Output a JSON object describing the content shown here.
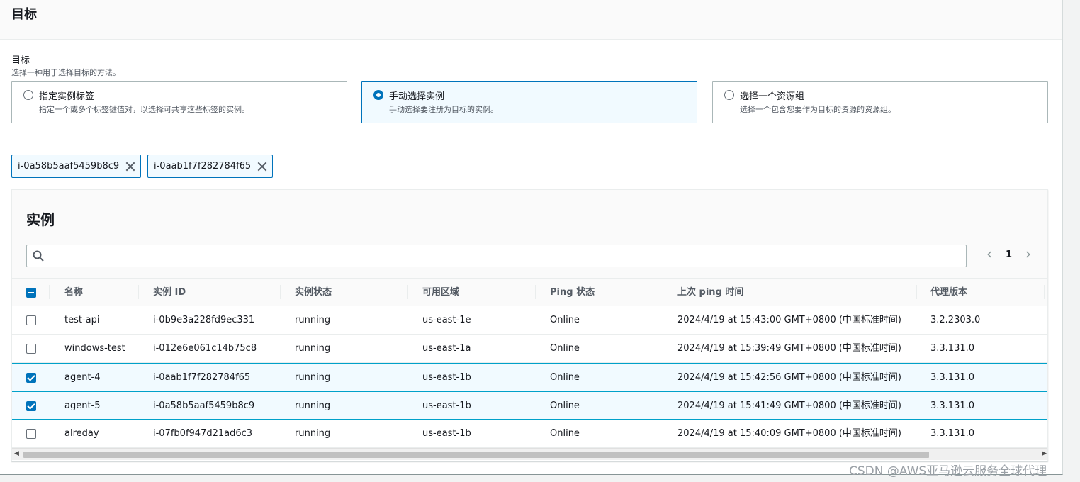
{
  "panel": {
    "title": "目标"
  },
  "field": {
    "label": "目标",
    "description": "选择一种用于选择目标的方法。"
  },
  "tiles": [
    {
      "label": "指定实例标签",
      "description": "指定一个或多个标签键值对，以选择可共享这些标签的实例。",
      "selected": false
    },
    {
      "label": "手动选择实例",
      "description": "手动选择要注册为目标的实例。",
      "selected": true
    },
    {
      "label": "选择一个资源组",
      "description": "选择一个包含您要作为目标的资源的资源组。",
      "selected": false
    }
  ],
  "tokens": [
    "i-0a58b5aaf5459b8c9",
    "i-0aab1f7f282784f65"
  ],
  "table": {
    "title": "实例",
    "search": {
      "value": "",
      "placeholder": ""
    },
    "pagination": {
      "current_page": "1"
    },
    "columns": [
      "名称",
      "实例 ID",
      "实例状态",
      "可用区域",
      "Ping 状态",
      "上次 ping 时间",
      "代理版本"
    ],
    "rows": [
      {
        "checked": false,
        "cells": [
          "test-api",
          "i-0b9e3a228fd9ec331",
          "running",
          "us-east-1e",
          "Online",
          "2024/4/19 at 15:43:00 GMT+0800 (中国标准时间)",
          "3.2.2303.0"
        ]
      },
      {
        "checked": false,
        "cells": [
          "windows-test",
          "i-012e6e061c14b75c8",
          "running",
          "us-east-1a",
          "Online",
          "2024/4/19 at 15:39:49 GMT+0800 (中国标准时间)",
          "3.3.131.0"
        ]
      },
      {
        "checked": true,
        "cells": [
          "agent-4",
          "i-0aab1f7f282784f65",
          "running",
          "us-east-1b",
          "Online",
          "2024/4/19 at 15:42:56 GMT+0800 (中国标准时间)",
          "3.3.131.0"
        ]
      },
      {
        "checked": true,
        "cells": [
          "agent-5",
          "i-0a58b5aaf5459b8c9",
          "running",
          "us-east-1b",
          "Online",
          "2024/4/19 at 15:41:49 GMT+0800 (中国标准时间)",
          "3.3.131.0"
        ]
      },
      {
        "checked": false,
        "cells": [
          "alreday",
          "i-07fb0f947d21ad6c3",
          "running",
          "us-east-1b",
          "Online",
          "2024/4/19 at 15:40:09 GMT+0800 (中国标准时间)",
          "3.3.131.0"
        ]
      }
    ]
  },
  "watermark": "CSDN @AWS亚马逊云服务全球代理",
  "colors": {
    "accent": "#0073bb",
    "selected_bg": "#f1faff",
    "selected_border": "#00a1c9"
  }
}
